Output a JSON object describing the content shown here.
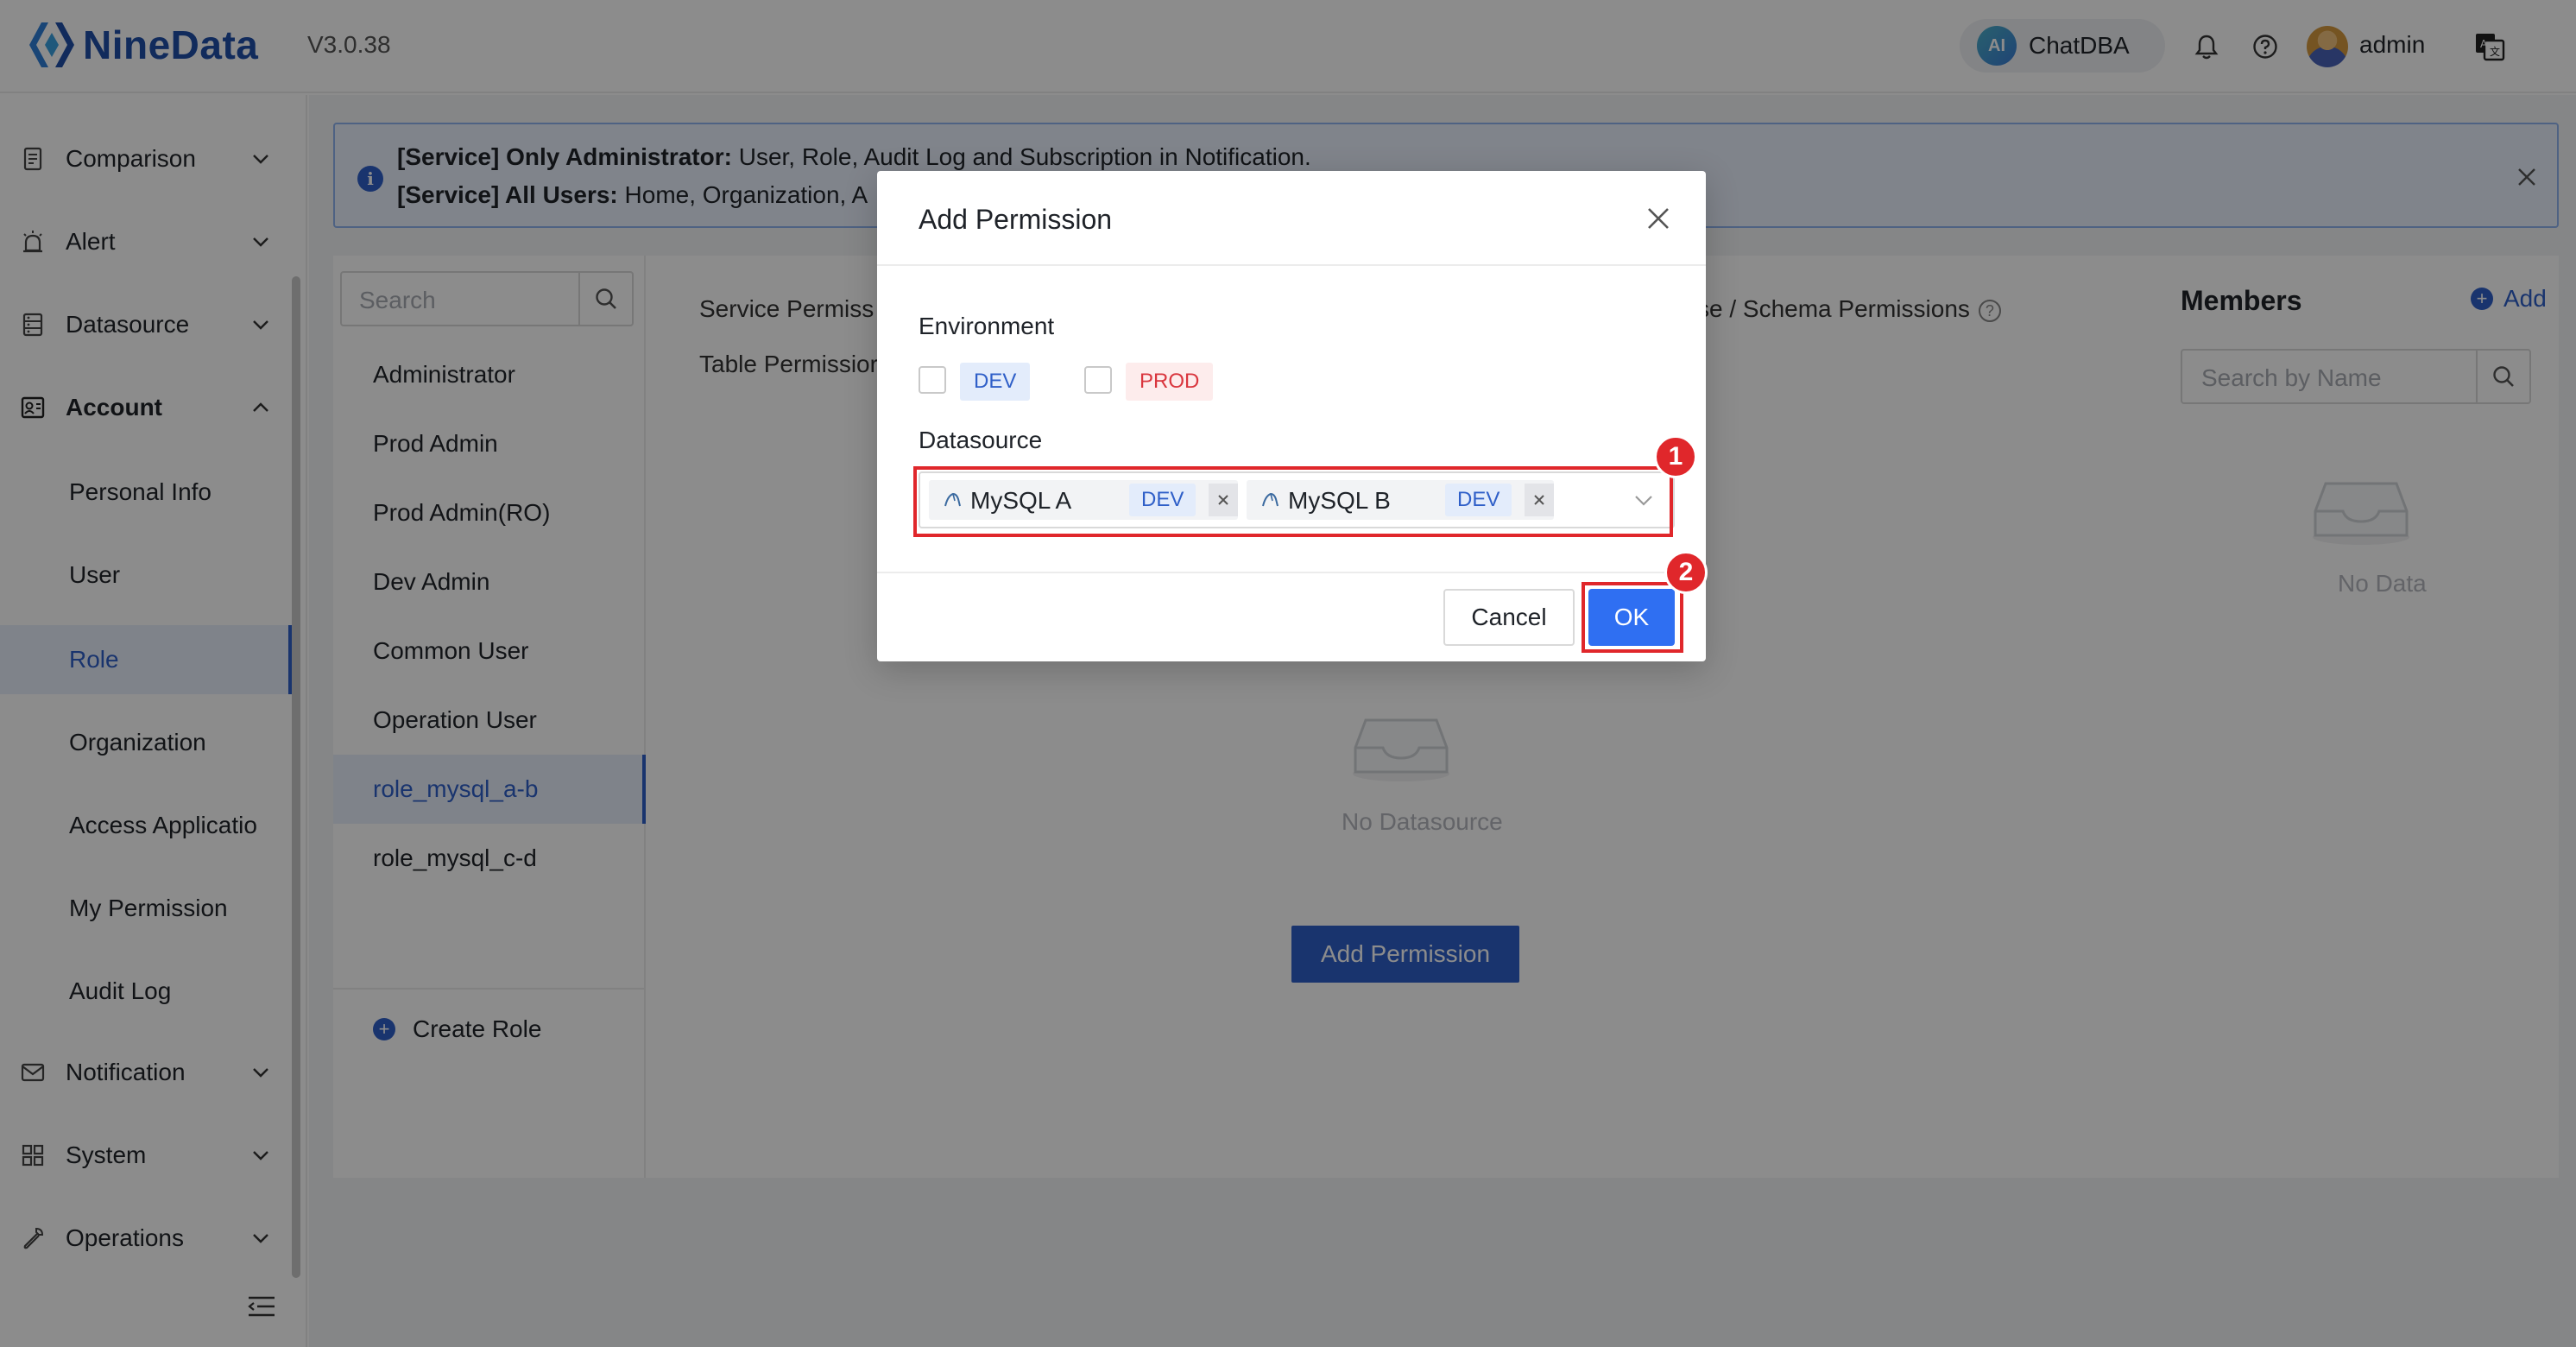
{
  "header": {
    "brand": "NineData",
    "version": "V3.0.38",
    "chatdba_label": "ChatDBA",
    "chatdba_badge": "AI",
    "user_name": "admin",
    "icons": [
      "bell-icon",
      "help-icon",
      "language-icon"
    ]
  },
  "sidebar": {
    "items": [
      {
        "label": "Comparison",
        "icon": "comparison-icon"
      },
      {
        "label": "Alert",
        "icon": "alert-icon"
      },
      {
        "label": "Datasource",
        "icon": "datasource-icon"
      },
      {
        "label": "Account",
        "icon": "account-icon",
        "expanded": true
      }
    ],
    "sub_items": [
      {
        "label": "Personal Info"
      },
      {
        "label": "User"
      },
      {
        "label": "Role",
        "active": true
      },
      {
        "label": "Organization"
      },
      {
        "label": "Access Applicatio"
      },
      {
        "label": "My Permission"
      },
      {
        "label": "Audit Log"
      }
    ],
    "bottom_items": [
      {
        "label": "Notification",
        "icon": "mail-icon"
      },
      {
        "label": "System",
        "icon": "grid-icon"
      },
      {
        "label": "Operations",
        "icon": "wrench-icon"
      }
    ]
  },
  "banner": {
    "line1_bold": "[Service] Only Administrator:",
    "line1_text": " User, Role, Audit Log and Subscription in Notification.",
    "line2_bold": "[Service] All Users:",
    "line2_text": " Home, Organization, A"
  },
  "roles": {
    "search_placeholder": "Search",
    "items": [
      {
        "label": "Administrator"
      },
      {
        "label": "Prod Admin"
      },
      {
        "label": "Prod Admin(RO)"
      },
      {
        "label": "Dev Admin"
      },
      {
        "label": "Common User"
      },
      {
        "label": "Operation User"
      },
      {
        "label": "role_mysql_a-b",
        "active": true
      },
      {
        "label": "role_mysql_c-d"
      }
    ],
    "create_label": "Create Role"
  },
  "permissions": {
    "tab_service": "Service Permiss",
    "tab_table": "Table Permissior",
    "tab_schema": "se / Schema Permissions",
    "empty_text": "No Datasource",
    "add_button": "Add Permission"
  },
  "members": {
    "title": "Members",
    "add_label": "Add",
    "search_placeholder": "Search by Name",
    "empty_text": "No Data"
  },
  "modal": {
    "title": "Add Permission",
    "environment_label": "Environment",
    "environments": [
      {
        "label": "DEV",
        "checked": false,
        "color": "#2f5fc8"
      },
      {
        "label": "PROD",
        "checked": false,
        "color": "#d9363e"
      }
    ],
    "datasource_label": "Datasource",
    "selected_datasources": [
      {
        "name": "MySQL A",
        "env": "DEV"
      },
      {
        "name": "MySQL B",
        "env": "DEV"
      }
    ],
    "cancel_label": "Cancel",
    "ok_label": "OK"
  },
  "annotations": {
    "step1": "1",
    "step2": "2",
    "color": "#e0272b"
  },
  "colors": {
    "accent": "#2f5fc8",
    "ok_button": "#2f6ff2",
    "overlay": "rgba(0,0,0,0.45)"
  }
}
